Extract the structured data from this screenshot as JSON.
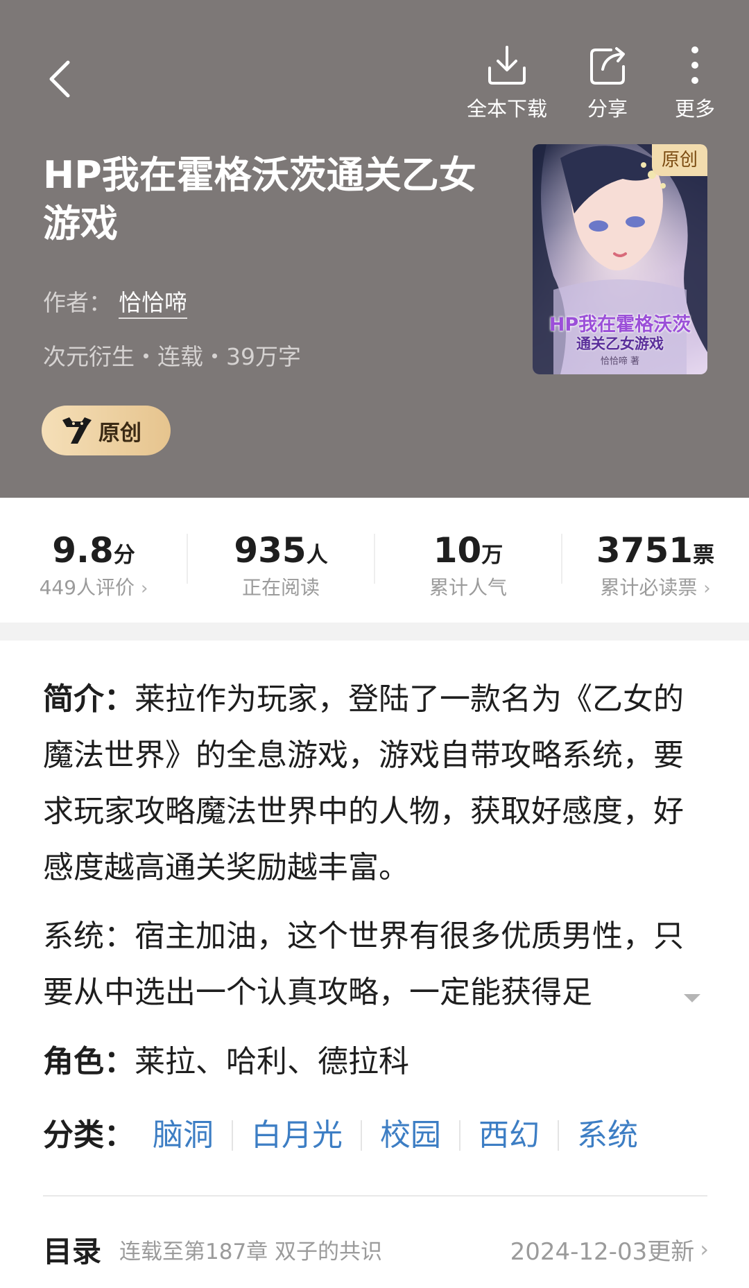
{
  "header": {
    "back_icon": "chevron-left-icon",
    "tools": [
      {
        "label": "全本下载",
        "icon": "download-icon"
      },
      {
        "label": "分享",
        "icon": "share-icon"
      },
      {
        "label": "更多",
        "icon": "more-vertical-icon"
      }
    ]
  },
  "book": {
    "title": "HP我在霍格沃茨通关乙女游戏",
    "author_label": "作者：",
    "author": "恰恰啼",
    "meta": "次元衍生・连载・39万字",
    "badge": "原创",
    "cover": {
      "tag": "原创",
      "title_line1": "HP我在霍格沃茨",
      "title_line2": "通关乙女游戏",
      "author": "恰恰啼 著"
    }
  },
  "stats": [
    {
      "value": "9.8",
      "unit": "分",
      "label": "449人评价",
      "chevron": true
    },
    {
      "value": "935",
      "unit": "人",
      "label": "正在阅读",
      "chevron": false
    },
    {
      "value": "10",
      "unit": "万",
      "label": "累计人气",
      "chevron": false
    },
    {
      "value": "3751",
      "unit": "票",
      "label": "累计必读票",
      "chevron": true
    }
  ],
  "intro": {
    "label": "简介：",
    "text": "莱拉作为玩家，登陆了一款名为《乙女的魔法世界》的全息游戏，游戏自带攻略系统，要求玩家攻略魔法世界中的人物，获取好感度，好感度越高通关奖励越丰富。",
    "text2": "系统：宿主加油，这个世界有很多优质男性，只要从中选出一个认真攻略，一定能获得足"
  },
  "roles": {
    "label": "角色：",
    "text": "莱拉、哈利、德拉科"
  },
  "categories": {
    "label": "分类：",
    "tags": [
      "脑洞",
      "白月光",
      "校园",
      "西幻",
      "系统"
    ]
  },
  "toc": {
    "label": "目录",
    "status": "连载至第187章  双子的共识",
    "updated": "2024-12-03更新"
  },
  "colors": {
    "header_bg": "#7d7877",
    "link_blue": "#3d7ec4",
    "badge_gold": "#e6c48e"
  }
}
